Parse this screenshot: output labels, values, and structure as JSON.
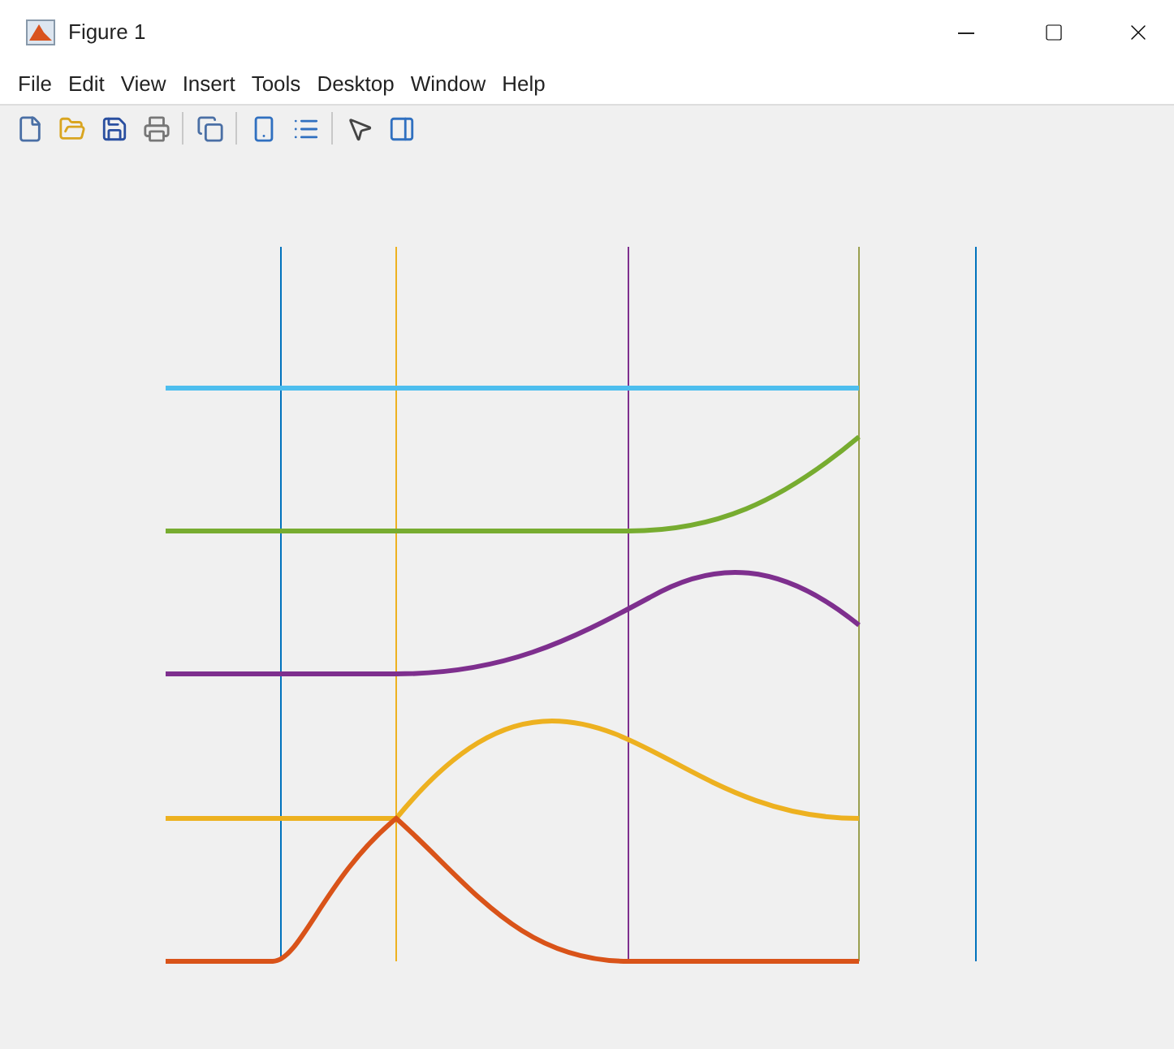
{
  "window": {
    "title": "Figure 1"
  },
  "menu": [
    "File",
    "Edit",
    "View",
    "Insert",
    "Tools",
    "Desktop",
    "Window",
    "Help"
  ]
}
